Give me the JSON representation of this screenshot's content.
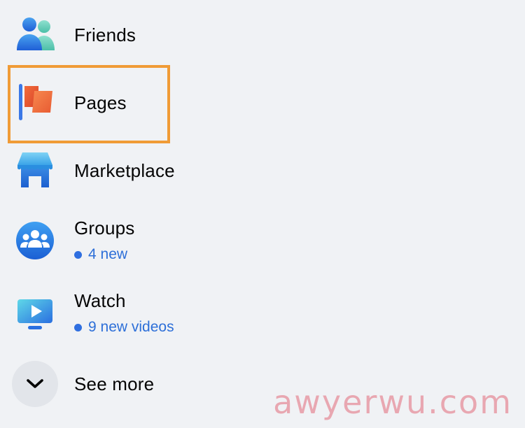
{
  "menu": {
    "friends": {
      "label": "Friends",
      "icon": "friends-icon"
    },
    "pages": {
      "label": "Pages",
      "icon": "pages-flag-icon",
      "highlighted": true
    },
    "marketplace": {
      "label": "Marketplace",
      "icon": "marketplace-store-icon"
    },
    "groups": {
      "label": "Groups",
      "subtitle": "4 new",
      "icon": "groups-icon"
    },
    "watch": {
      "label": "Watch",
      "subtitle": "9 new videos",
      "icon": "watch-play-icon"
    },
    "see_more": {
      "label": "See more",
      "icon": "chevron-down-icon"
    }
  },
  "colors": {
    "background": "#f0f2f5",
    "highlight": "#f09b36",
    "accent_blue": "#2f6fe0"
  },
  "watermark": {
    "text": "awyerwu.com"
  }
}
